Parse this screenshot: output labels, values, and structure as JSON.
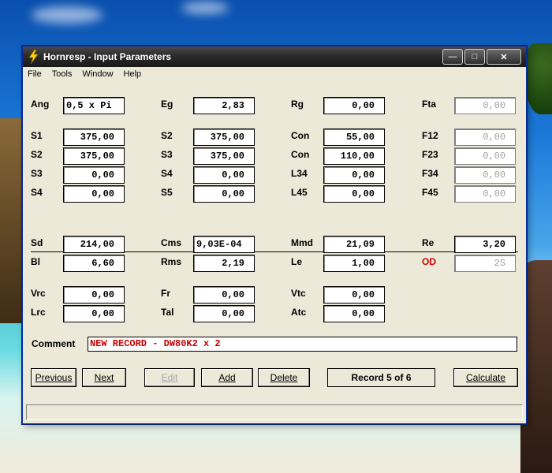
{
  "window": {
    "title": "Hornresp - Input Parameters"
  },
  "menu": [
    "File",
    "Tools",
    "Window",
    "Help"
  ],
  "fields": {
    "ang": {
      "label": "Ang",
      "value": "0,5 x Pi"
    },
    "eg": {
      "label": "Eg",
      "value": "2,83"
    },
    "rg": {
      "label": "Rg",
      "value": "0,00"
    },
    "fta": {
      "label": "Fta",
      "value": "0,00"
    },
    "s1": {
      "label": "S1",
      "value": "375,00"
    },
    "s2b": {
      "label": "S2",
      "value": "375,00"
    },
    "con1": {
      "label": "Con",
      "value": "55,00"
    },
    "f12": {
      "label": "F12",
      "value": "0,00"
    },
    "s2": {
      "label": "S2",
      "value": "375,00"
    },
    "s3b": {
      "label": "S3",
      "value": "375,00"
    },
    "con2": {
      "label": "Con",
      "value": "110,00"
    },
    "f23": {
      "label": "F23",
      "value": "0,00"
    },
    "s3": {
      "label": "S3",
      "value": "0,00"
    },
    "s4b": {
      "label": "S4",
      "value": "0,00"
    },
    "l34": {
      "label": "L34",
      "value": "0,00"
    },
    "f34": {
      "label": "F34",
      "value": "0,00"
    },
    "s4": {
      "label": "S4",
      "value": "0,00"
    },
    "s5": {
      "label": "S5",
      "value": "0,00"
    },
    "l45": {
      "label": "L45",
      "value": "0,00"
    },
    "f45": {
      "label": "F45",
      "value": "0,00"
    },
    "sd": {
      "label": "Sd",
      "value": "214,00"
    },
    "cms": {
      "label": "Cms",
      "value": "9,03E-04"
    },
    "mmd": {
      "label": "Mmd",
      "value": "21,09"
    },
    "re": {
      "label": "Re",
      "value": "3,20"
    },
    "bl": {
      "label": "Bl",
      "value": "6,60"
    },
    "rms": {
      "label": "Rms",
      "value": "2,19"
    },
    "le": {
      "label": "Le",
      "value": "1,00"
    },
    "od": {
      "label": "OD",
      "value": "2S"
    },
    "vrc": {
      "label": "Vrc",
      "value": "0,00"
    },
    "fr": {
      "label": "Fr",
      "value": "0,00"
    },
    "vtc": {
      "label": "Vtc",
      "value": "0,00"
    },
    "lrc": {
      "label": "Lrc",
      "value": "0,00"
    },
    "tal": {
      "label": "Tal",
      "value": "0,00"
    },
    "atc": {
      "label": "Atc",
      "value": "0,00"
    }
  },
  "comment": {
    "label": "Comment",
    "value": "NEW RECORD - DW80K2 x 2"
  },
  "buttons": {
    "previous": "Previous",
    "next": "Next",
    "edit": "Edit",
    "add": "Add",
    "delete": "Delete",
    "calculate": "Calculate"
  },
  "record": "Record 5 of 6",
  "colors": {
    "od_label": "#d00000",
    "comment_text": "#c80000"
  }
}
